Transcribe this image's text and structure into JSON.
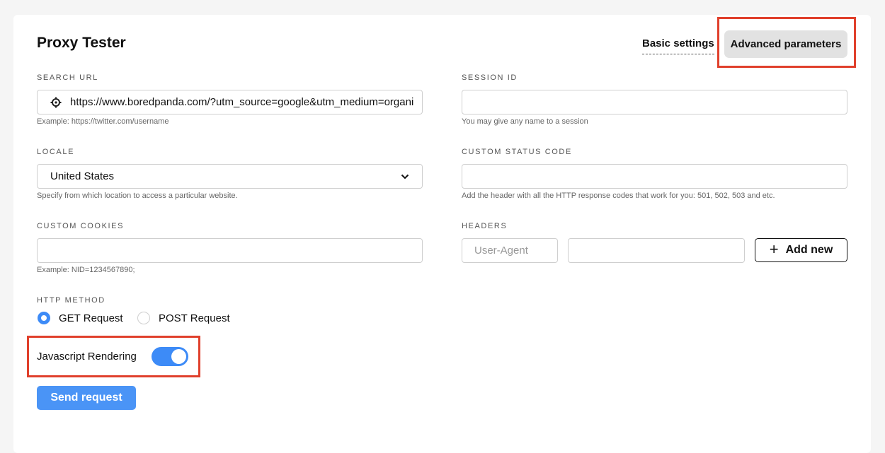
{
  "title": "Proxy Tester",
  "tabs": {
    "basic": "Basic settings",
    "advanced": "Advanced parameters"
  },
  "search_url": {
    "label": "SEARCH URL",
    "value": "https://www.boredpanda.com/?utm_source=google&utm_medium=organic",
    "hint": "Example: https://twitter.com/username"
  },
  "session_id": {
    "label": "SESSION ID",
    "value": "",
    "hint": "You may give any name to a session"
  },
  "locale": {
    "label": "LOCALE",
    "selected": "United States",
    "hint": "Specify from which location to access a particular website."
  },
  "custom_status_code": {
    "label": "CUSTOM STATUS CODE",
    "value": "",
    "hint": "Add the header with all the HTTP response codes that work for you: 501, 502, 503 and etc."
  },
  "custom_cookies": {
    "label": "CUSTOM COOKIES",
    "value": "",
    "hint": "Example: NID=1234567890;"
  },
  "headers": {
    "label": "HEADERS",
    "name_placeholder": "User-Agent",
    "value": "",
    "add_label": "Add new"
  },
  "http_method": {
    "label": "HTTP METHOD",
    "options": [
      "GET Request",
      "POST Request"
    ],
    "selected": "GET Request"
  },
  "js_rendering": {
    "label": "Javascript Rendering",
    "enabled": true
  },
  "send_label": "Send request",
  "colors": {
    "accent": "#3d8bf7",
    "highlight": "#e0402c"
  }
}
